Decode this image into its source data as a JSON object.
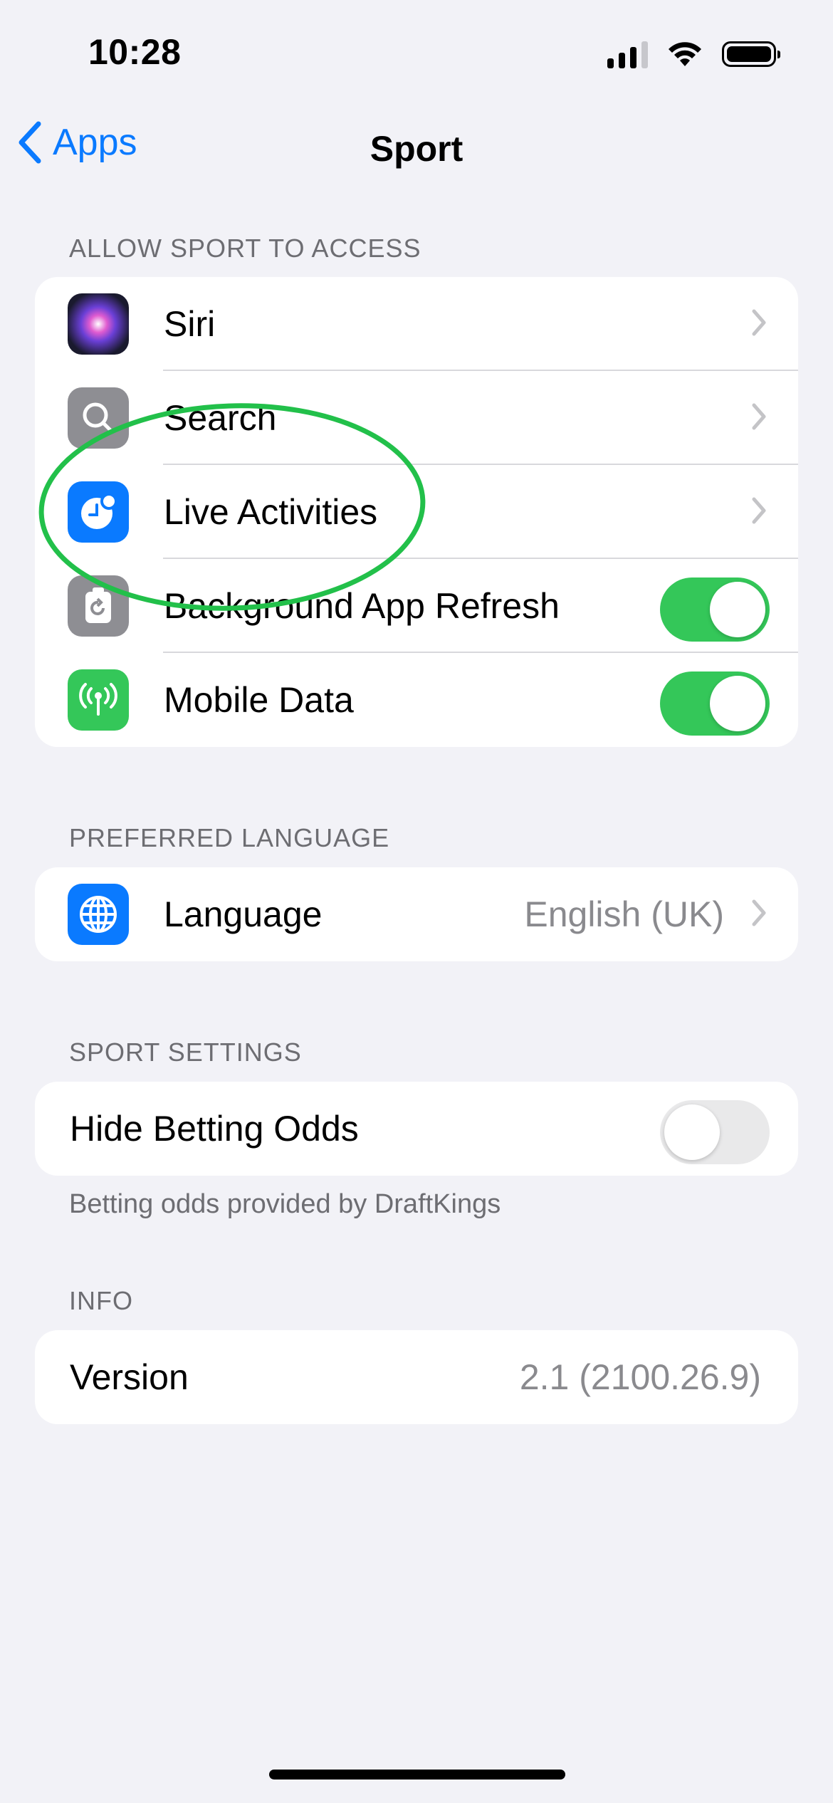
{
  "status_bar": {
    "time": "10:28",
    "icons": [
      "cellular-signal-icon",
      "wifi-icon",
      "battery-icon"
    ]
  },
  "nav": {
    "back_label": "Apps",
    "title": "Sport"
  },
  "sections": {
    "access": {
      "header": "ALLOW SPORT TO ACCESS",
      "rows": [
        {
          "label": "Siri",
          "icon": "siri-icon",
          "control": "chevron"
        },
        {
          "label": "Search",
          "icon": "search-icon",
          "control": "chevron"
        },
        {
          "label": "Live Activities",
          "icon": "live-activities-icon",
          "control": "chevron"
        },
        {
          "label": "Background App Refresh",
          "icon": "background-refresh-icon",
          "control": "toggle",
          "value": true
        },
        {
          "label": "Mobile Data",
          "icon": "antenna-icon",
          "control": "toggle",
          "value": true
        }
      ]
    },
    "language": {
      "header": "PREFERRED LANGUAGE",
      "row": {
        "label": "Language",
        "value": "English (UK)",
        "icon": "globe-icon"
      }
    },
    "sport_settings": {
      "header": "SPORT SETTINGS",
      "row": {
        "label": "Hide Betting Odds",
        "value": false
      },
      "footer": "Betting odds provided by DraftKings"
    },
    "info": {
      "header": "INFO",
      "row": {
        "label": "Version",
        "value": "2.1 (2100.26.9)"
      }
    }
  },
  "colors": {
    "accent": "#0a7aff",
    "toggle_on": "#34c759",
    "annotation": "#22c04a",
    "background": "#f2f2f7"
  }
}
